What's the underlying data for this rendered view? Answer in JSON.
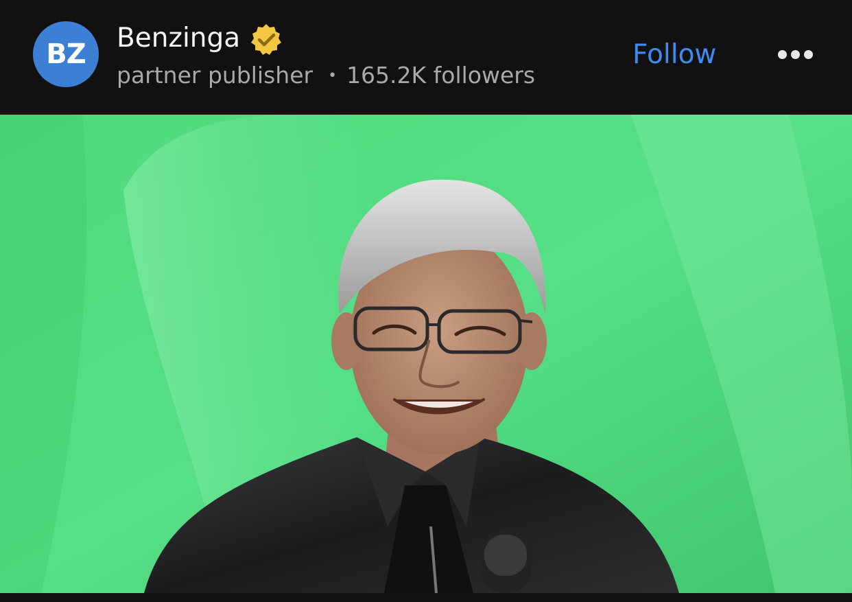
{
  "publisher": {
    "avatar_text": "BZ",
    "name": "Benzinga",
    "verified_icon": "verified-badge-icon",
    "role": "partner publisher",
    "separator": "•",
    "followers": "165.2K followers"
  },
  "actions": {
    "follow_label": "Follow",
    "more_icon": "more-options-icon"
  },
  "colors": {
    "background": "#111112",
    "avatar": "#3d7fd4",
    "follow": "#3e8bf2",
    "verified": "#f2c744",
    "photo_background": "#4bd97a"
  }
}
